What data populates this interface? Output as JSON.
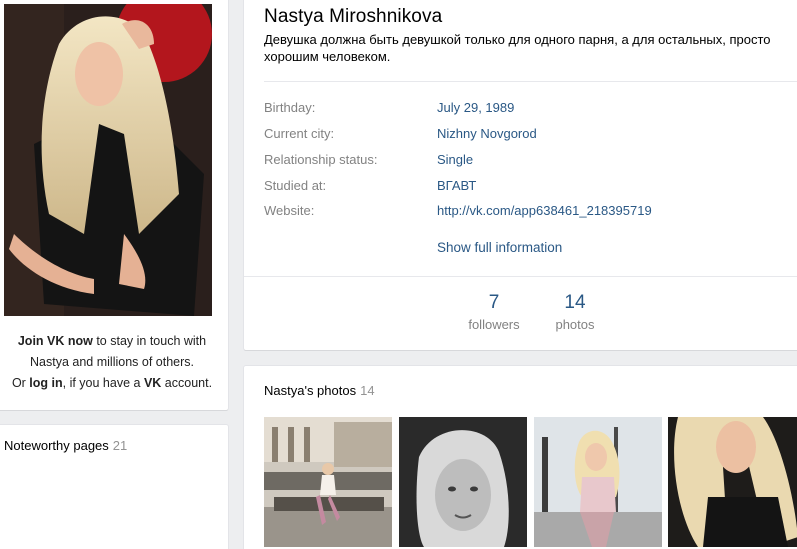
{
  "profile": {
    "name": "Nastya Miroshnikova",
    "status": "Девушка должна быть девушкой только для одного парня, а для остальных, просто хорошим человеком."
  },
  "info": [
    {
      "label": "Birthday:",
      "value": "July 29, 1989"
    },
    {
      "label": "Current city:",
      "value": "Nizhny Novgorod"
    },
    {
      "label": "Relationship status:",
      "value": "Single"
    },
    {
      "label": "Studied at:",
      "value": "ВГАВТ"
    },
    {
      "label": "Website:",
      "value": "http://vk.com/app638461_218395719"
    }
  ],
  "show_full": "Show full information",
  "counters": {
    "followers": {
      "num": "7",
      "label": "followers"
    },
    "photos": {
      "num": "14",
      "label": "photos"
    }
  },
  "join": {
    "bold1": "Join VK now",
    "text1": " to stay in touch with",
    "text2": "Nastya and millions of others.",
    "text3a": "Or ",
    "bold2": "log in",
    "text3b": ", if you have a ",
    "bold3": "VK",
    "text3c": " account."
  },
  "noteworthy": {
    "title": "Noteworthy pages",
    "count": "21"
  },
  "photos_section": {
    "title": "Nastya's photos",
    "count": "14"
  },
  "colors": {
    "background": "#edeef0",
    "link": "#2a5885",
    "label_gray": "#828282"
  }
}
